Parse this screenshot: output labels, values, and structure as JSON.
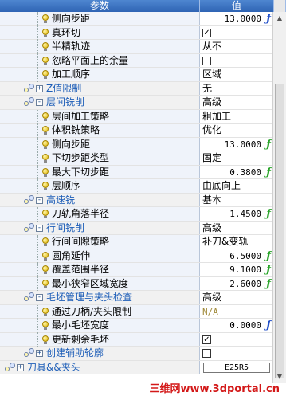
{
  "header": {
    "param": "参数",
    "value": "值"
  },
  "rows": [
    {
      "kind": "param",
      "indent": 1,
      "label": "侧向步距",
      "value": "13.0000",
      "vtype": "num",
      "fx": "blue"
    },
    {
      "kind": "param",
      "indent": 1,
      "label": "真环切",
      "value": "",
      "vtype": "check",
      "checked": true
    },
    {
      "kind": "param",
      "indent": 1,
      "label": "半精轨迹",
      "value": "从不",
      "vtype": "text"
    },
    {
      "kind": "param",
      "indent": 1,
      "label": "忽略平面上的余量",
      "value": "",
      "vtype": "check",
      "checked": false
    },
    {
      "kind": "param",
      "indent": 1,
      "label": "加工顺序",
      "value": "区域",
      "vtype": "text"
    },
    {
      "kind": "group",
      "indent": 0,
      "toggle": "+",
      "label": "Z值限制",
      "value": "无",
      "vtype": "text"
    },
    {
      "kind": "group",
      "indent": 0,
      "toggle": "-",
      "label": "层间铣削",
      "value": "高级",
      "vtype": "text"
    },
    {
      "kind": "param",
      "indent": 1,
      "label": "层间加工策略",
      "value": "粗加工",
      "vtype": "text"
    },
    {
      "kind": "param",
      "indent": 1,
      "label": "体积铣策略",
      "value": "优化",
      "vtype": "text"
    },
    {
      "kind": "param",
      "indent": 1,
      "label": "侧向步距",
      "value": "13.0000",
      "vtype": "num",
      "fx": "green"
    },
    {
      "kind": "param",
      "indent": 1,
      "label": "下切步距类型",
      "value": "固定",
      "vtype": "text"
    },
    {
      "kind": "param",
      "indent": 1,
      "label": "最大下切步距",
      "value": "0.3800",
      "vtype": "num",
      "fx": "green"
    },
    {
      "kind": "param",
      "indent": 1,
      "label": "层顺序",
      "value": "由底向上",
      "vtype": "text"
    },
    {
      "kind": "group",
      "indent": 0,
      "toggle": "-",
      "label": "高速铣",
      "value": "基本",
      "vtype": "text"
    },
    {
      "kind": "param",
      "indent": 1,
      "label": "刀轨角落半径",
      "value": "1.4500",
      "vtype": "num",
      "fx": "green"
    },
    {
      "kind": "group",
      "indent": 0,
      "toggle": "-",
      "label": "行间铣削",
      "value": "高级",
      "vtype": "text"
    },
    {
      "kind": "param",
      "indent": 1,
      "label": "行间间隙策略",
      "value": "补刀&变轨",
      "vtype": "text"
    },
    {
      "kind": "param",
      "indent": 1,
      "label": "圆角延伸",
      "value": "6.5000",
      "vtype": "num",
      "fx": "green"
    },
    {
      "kind": "param",
      "indent": 1,
      "label": "覆盖范围半径",
      "value": "9.1000",
      "vtype": "num",
      "fx": "green"
    },
    {
      "kind": "param",
      "indent": 1,
      "label": "最小狭窄区域宽度",
      "value": "2.6000",
      "vtype": "num",
      "fx": "green"
    },
    {
      "kind": "group",
      "indent": 0,
      "toggle": "-",
      "label": "毛坯管理与夹头检查",
      "value": "高级",
      "vtype": "text"
    },
    {
      "kind": "param",
      "indent": 1,
      "label": "通过刀柄/夹头限制",
      "value": "N/A",
      "vtype": "na"
    },
    {
      "kind": "param",
      "indent": 1,
      "label": "最小毛坯宽度",
      "value": "0.0000",
      "vtype": "num",
      "fx": "blue"
    },
    {
      "kind": "param",
      "indent": 1,
      "label": "更新剩余毛坯",
      "value": "",
      "vtype": "check",
      "checked": true
    },
    {
      "kind": "group",
      "indent": 0,
      "toggle": "+",
      "label": "创建辅助轮廓",
      "value": "",
      "vtype": "check",
      "checked": false
    },
    {
      "kind": "group",
      "indent": -1,
      "toggle": "+",
      "label": "刀具&&夹头",
      "value": "E25R5",
      "vtype": "select"
    }
  ],
  "watermark": "三维网www.3dportal.cn"
}
